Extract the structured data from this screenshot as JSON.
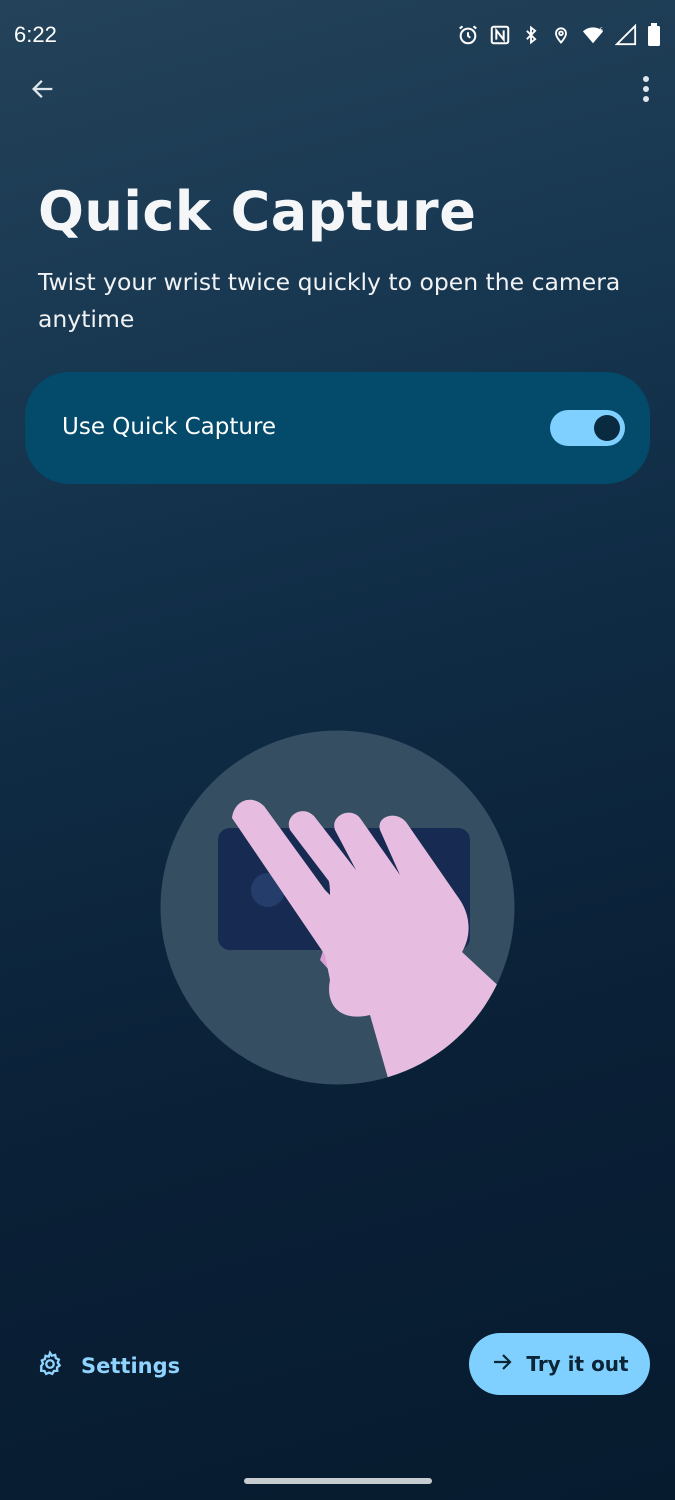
{
  "status_bar": {
    "time": "6:22",
    "icons": [
      "alarm-icon",
      "nfc-icon",
      "bluetooth-icon",
      "location-icon",
      "wifi-icon",
      "signal-icon",
      "battery-icon"
    ]
  },
  "header": {
    "back_icon": "arrow-left-icon",
    "more_icon": "more-vert-icon"
  },
  "main": {
    "title": "Quick Capture",
    "description": "Twist your wrist twice quickly to open the camera anytime",
    "toggle": {
      "label": "Use Quick Capture",
      "checked": true
    },
    "illustration": "hand-twisting-phone-illustration"
  },
  "footer": {
    "settings_label": "Settings",
    "settings_icon": "gear-icon",
    "try_label": "Try it out",
    "try_icon": "arrow-right-icon"
  },
  "colors": {
    "accent": "#7fd0ff",
    "card": "#044a6b",
    "background": "#0a2036",
    "hand": "#e6bde0",
    "phone": "#172a52"
  }
}
